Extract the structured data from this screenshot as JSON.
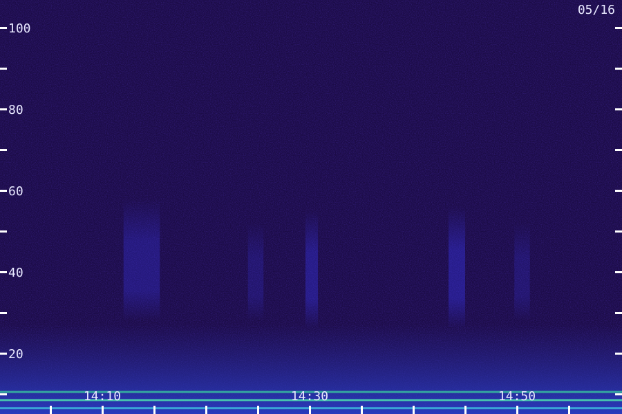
{
  "chart_data": {
    "type": "heatmap",
    "title": "",
    "date_label": "05/16",
    "y_ticks": [
      20,
      40,
      60,
      80,
      100
    ],
    "ylim": [
      0,
      100
    ],
    "x_tick_labels": [
      "14:10",
      "14:30",
      "14:50"
    ],
    "x_tick_minutes": [
      10,
      30,
      50
    ],
    "xlim_minutes": [
      0,
      58
    ],
    "background_color": "#1c0c48",
    "activity_bands": [
      {
        "x_minute": 13.8,
        "width_minutes": 3.5,
        "y_low": 28,
        "y_high": 58,
        "intensity": 0.5
      },
      {
        "x_minute": 30.2,
        "width_minutes": 1.2,
        "y_low": 26,
        "y_high": 55,
        "intensity": 0.6
      },
      {
        "x_minute": 44.2,
        "width_minutes": 1.6,
        "y_low": 26,
        "y_high": 56,
        "intensity": 0.65
      },
      {
        "x_minute": 24.8,
        "width_minutes": 1.5,
        "y_low": 28,
        "y_high": 52,
        "intensity": 0.35
      },
      {
        "x_minute": 50.5,
        "width_minutes": 1.5,
        "y_low": 28,
        "y_high": 52,
        "intensity": 0.35
      }
    ],
    "low_freq_lines": [
      {
        "y": 10.5,
        "color": "#3ad0a0"
      },
      {
        "y": 8.5,
        "color": "#50f0b0"
      },
      {
        "y": 6.5,
        "color": "#40c8e0"
      },
      {
        "y": 4.5,
        "color": "#60f080"
      }
    ]
  }
}
